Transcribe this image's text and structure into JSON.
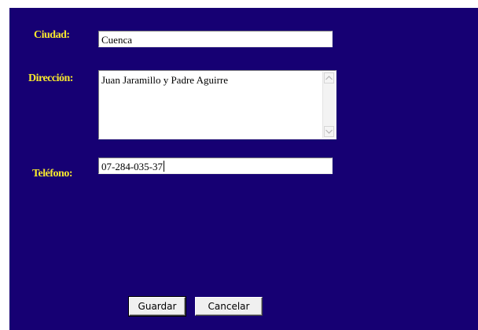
{
  "form": {
    "ciudad": {
      "label": "Ciudad:",
      "value": "Cuenca"
    },
    "direccion": {
      "label": "Dirección:",
      "value": "Juan Jaramillo y Padre Aguirre"
    },
    "telefono": {
      "label": "Teléfono:",
      "value": "07-284-035-37"
    }
  },
  "buttons": {
    "save_label": "Guardar",
    "cancel_label": "Cancelar"
  },
  "colors": {
    "background": "#160073",
    "label": "#f7e82e"
  }
}
